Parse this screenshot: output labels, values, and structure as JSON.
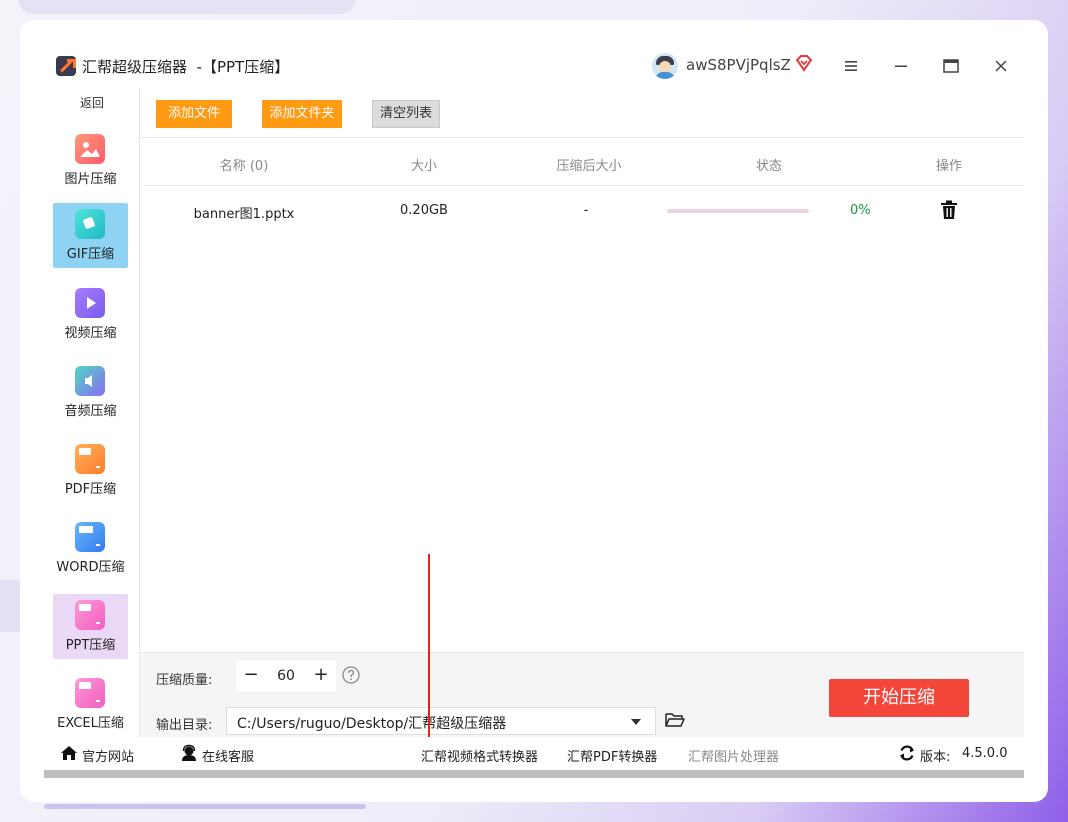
{
  "window": {
    "title": "汇帮超级压缩器  -【PPT压缩】",
    "username": "awS8PVjPqlsZ"
  },
  "sidebar": {
    "back_label": "返回",
    "items": [
      {
        "label": "图片压缩",
        "icon": "image-icon",
        "active": false
      },
      {
        "label": "GIF压缩",
        "icon": "gif-icon",
        "active": true
      },
      {
        "label": "视频压缩",
        "icon": "video-icon",
        "active": false
      },
      {
        "label": "音频压缩",
        "icon": "audio-icon",
        "active": false
      },
      {
        "label": "PDF压缩",
        "icon": "pdf-icon",
        "active": false
      },
      {
        "label": "WORD压缩",
        "icon": "word-icon",
        "active": false
      },
      {
        "label": "PPT压缩",
        "icon": "ppt-icon",
        "active": true
      },
      {
        "label": "EXCEL压缩",
        "icon": "excel-icon",
        "active": false
      }
    ]
  },
  "toolbar": {
    "add_file": "添加文件",
    "add_folder": "添加文件夹",
    "clear_list": "清空列表"
  },
  "table": {
    "headers": [
      "名称 (0)",
      "大小",
      "压缩后大小",
      "状态",
      "操作"
    ],
    "rows": [
      {
        "name": "banner图1.pptx",
        "size": "0.20GB",
        "compressed_size": "-",
        "progress": 0,
        "percent": "0%"
      }
    ]
  },
  "settings": {
    "quality_label": "压缩质量:",
    "quality_value": "60",
    "minus": "−",
    "plus": "+",
    "output_label": "输出目录:",
    "output_path": "C:/Users/ruguo/Desktop/汇帮超级压缩器",
    "start_button": "开始压缩"
  },
  "statusbar": {
    "website": "官方网站",
    "service": "在线客服",
    "video_converter": "汇帮视频格式转换器",
    "pdf_converter": "汇帮PDF转换器",
    "image_processor": "汇帮图片处理器",
    "version_label": "版本:",
    "version": "4.5.0.0"
  },
  "colors": {
    "accent_orange": "#ff9a12",
    "start_red": "#f4453b",
    "gif_active": "#8fd3f4",
    "ppt_active": "#ead9f6",
    "progress_green": "#1a9a3a"
  }
}
